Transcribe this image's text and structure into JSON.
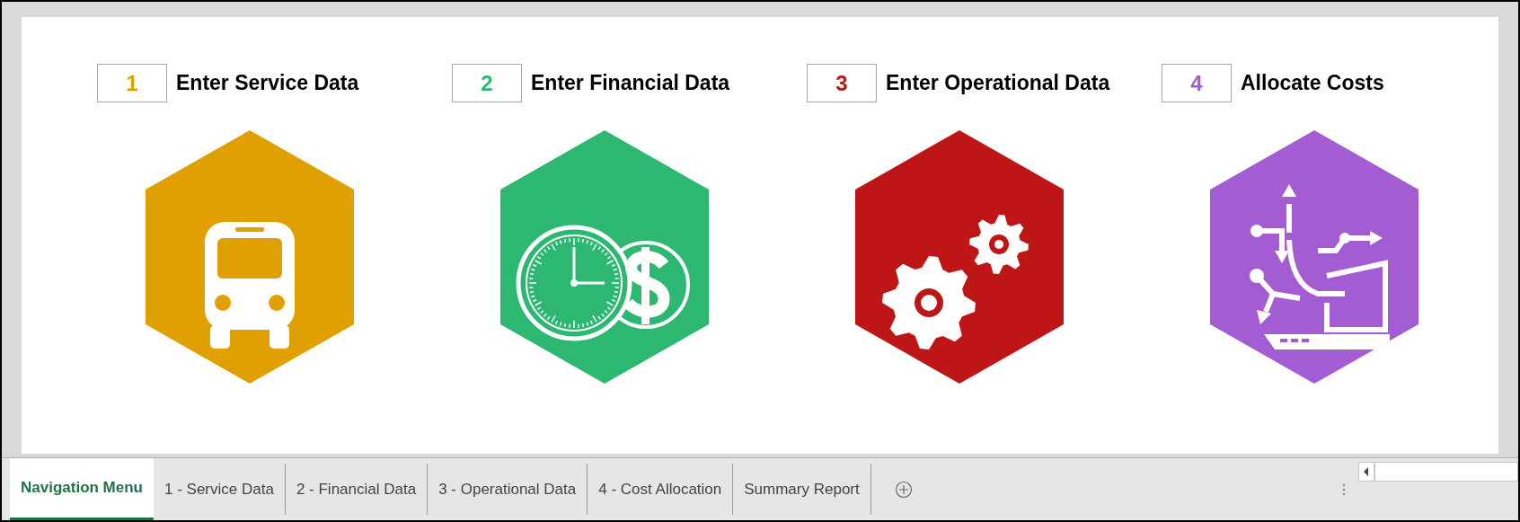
{
  "steps": [
    {
      "number": "1",
      "label": "Enter Service Data",
      "color": "#e0a000",
      "kind": "bus"
    },
    {
      "number": "2",
      "label": "Enter Financial Data",
      "color": "#2cb870",
      "kind": "finance"
    },
    {
      "number": "3",
      "label": "Enter Operational Data",
      "color": "#be1616",
      "kind": "gears"
    },
    {
      "number": "4",
      "label": "Allocate Costs",
      "color": "#a35cd2",
      "kind": "allocation"
    }
  ],
  "sheet_tabs": [
    {
      "label": "Navigation Menu",
      "selected": true
    },
    {
      "label": "1 - Service Data",
      "selected": false
    },
    {
      "label": "2 - Financial Data",
      "selected": false
    },
    {
      "label": "3 - Operational Data",
      "selected": false
    },
    {
      "label": "4 - Cost Allocation",
      "selected": false
    },
    {
      "label": "Summary Report",
      "selected": false
    }
  ]
}
